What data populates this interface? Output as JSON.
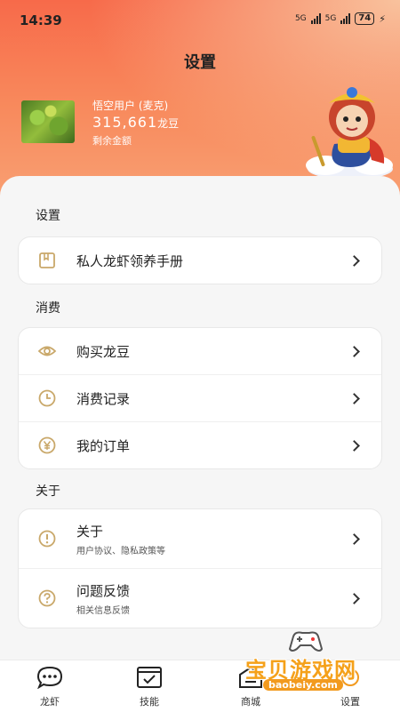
{
  "status_bar": {
    "time": "14:39",
    "network1": "5G",
    "network2": "5G",
    "battery": "74"
  },
  "header": {
    "title": "设置"
  },
  "profile": {
    "name": "悟空用户 (麦克)",
    "balance": "315,661",
    "balance_unit": "龙豆",
    "balance_label": "剩余金额"
  },
  "sections": {
    "settings": {
      "title": "设置",
      "items": [
        {
          "label": "私人龙虾领养手册",
          "icon": "book-icon"
        }
      ]
    },
    "consume": {
      "title": "消费",
      "items": [
        {
          "label": "购买龙豆",
          "icon": "eye-icon"
        },
        {
          "label": "消费记录",
          "icon": "clock-icon"
        },
        {
          "label": "我的订单",
          "icon": "yen-icon"
        }
      ]
    },
    "about": {
      "title": "关于",
      "items": [
        {
          "label": "关于",
          "sub": "用户协议、隐私政策等",
          "icon": "info-icon"
        },
        {
          "label": "问题反馈",
          "sub": "相关信息反馈",
          "icon": "question-icon"
        }
      ]
    }
  },
  "tabs": [
    {
      "label": "龙虾",
      "icon": "chat-bubble-icon"
    },
    {
      "label": "技能",
      "icon": "window-check-icon"
    },
    {
      "label": "商城",
      "icon": "shop-icon"
    },
    {
      "label": "设置",
      "icon": "settings-icon"
    }
  ],
  "watermark": {
    "text": "宝贝游戏网",
    "url": "baobeiy.com"
  },
  "colors": {
    "accent": "#c9a86a",
    "header_top": "#f76a4a",
    "header_bottom": "#f9a77a",
    "watermark": "#f5a11a"
  }
}
